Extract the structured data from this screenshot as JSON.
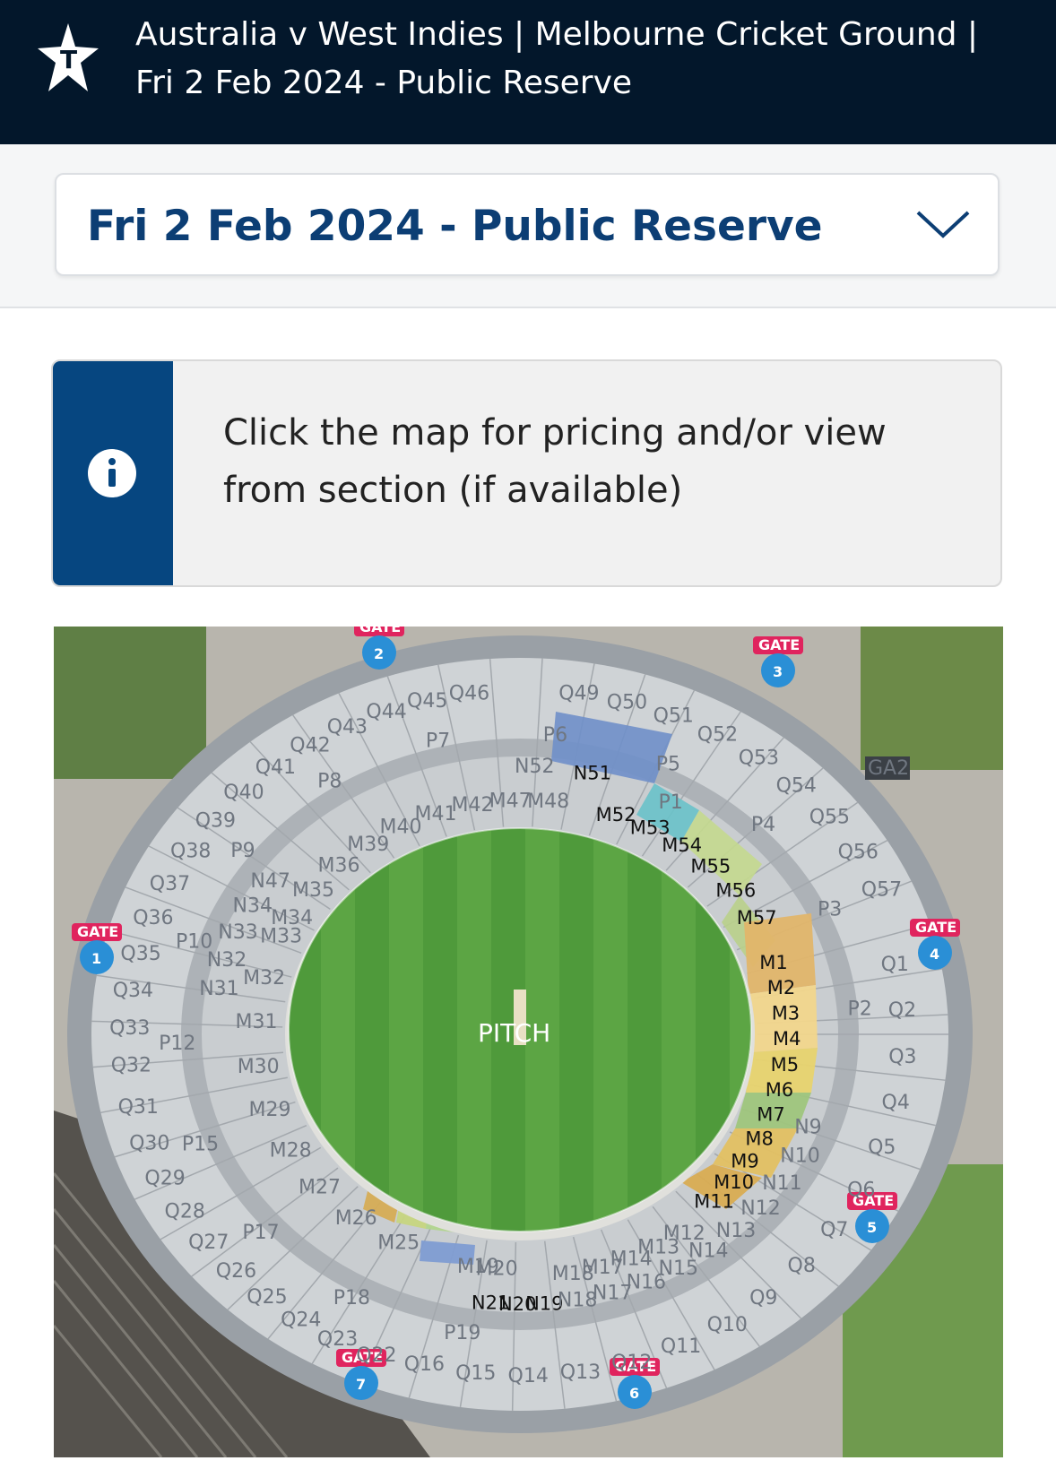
{
  "header": {
    "title_line1": "Australia v West Indies | Melbourne Cricket Ground |",
    "title_line2": "Fri 2 Feb 2024 - Public Reserve",
    "logo_letter": "T",
    "logo_icon": "star-logo-icon"
  },
  "session_select": {
    "selected": "Fri 2 Feb 2024 - Public Reserve",
    "icon": "chevron-down-icon"
  },
  "info": {
    "icon": "info-icon",
    "line1": "Click the map for pricing and/or view",
    "line2": "from section (if available)"
  },
  "map": {
    "center_label": "PITCH",
    "colors": {
      "header_bg": "#03172b",
      "accent_blue": "#0c3e74",
      "info_strip": "#064680",
      "field_green": "#4f9a3b",
      "gate_blue": "#2a8fd6",
      "gate_red": "#e0245e"
    },
    "gates": [
      {
        "number": "1",
        "label": "GATE"
      },
      {
        "number": "2",
        "label": "GATE"
      },
      {
        "number": "3",
        "label": "GATE"
      },
      {
        "number": "4",
        "label": "GATE"
      },
      {
        "number": "5",
        "label": "GATE"
      },
      {
        "number": "6",
        "label": "GATE"
      },
      {
        "number": "7",
        "label": "GATE"
      }
    ],
    "ga_label": "GA2",
    "outer_sections": [
      "Q1",
      "Q2",
      "Q3",
      "Q4",
      "Q5",
      "Q6",
      "Q7",
      "Q8",
      "Q9",
      "Q10",
      "Q11",
      "Q12",
      "Q13",
      "Q14",
      "Q15",
      "Q16",
      "Q22",
      "Q23",
      "Q24",
      "Q25",
      "Q26",
      "Q27",
      "Q28",
      "Q29",
      "Q30",
      "Q31",
      "Q32",
      "Q33",
      "Q34",
      "Q35",
      "Q36",
      "Q37",
      "Q38",
      "Q39",
      "Q40",
      "Q41",
      "Q42",
      "Q43",
      "Q44",
      "Q45",
      "Q46",
      "Q49",
      "Q50",
      "Q51",
      "Q52",
      "Q53",
      "Q54",
      "Q55",
      "Q56",
      "Q57"
    ],
    "middle_sections_available": [
      "M1",
      "M2",
      "M3",
      "M4",
      "M5",
      "M6",
      "M7",
      "M8",
      "M9",
      "M10",
      "M11",
      "M52",
      "M53",
      "M54",
      "M55",
      "M56",
      "M57",
      "N51",
      "N21",
      "N20",
      "N19"
    ],
    "middle_sections_other": [
      "M12",
      "M13",
      "M14",
      "M17",
      "M18",
      "M19",
      "M20",
      "M25",
      "M26",
      "M27",
      "M28",
      "M29",
      "M30",
      "M31",
      "M32",
      "M33",
      "M34",
      "M35",
      "M36",
      "M39",
      "M40",
      "M41",
      "M42",
      "M47",
      "M48",
      "N9",
      "N10",
      "N11",
      "N12",
      "N13",
      "N14",
      "N15",
      "N16",
      "N17",
      "N18",
      "N31",
      "N32",
      "N33",
      "N34",
      "N47",
      "N52",
      "P1",
      "P2",
      "P3",
      "P4",
      "P5",
      "P6",
      "P7",
      "P8",
      "P9",
      "P10",
      "P12",
      "P15",
      "P17",
      "P18",
      "P19"
    ]
  }
}
